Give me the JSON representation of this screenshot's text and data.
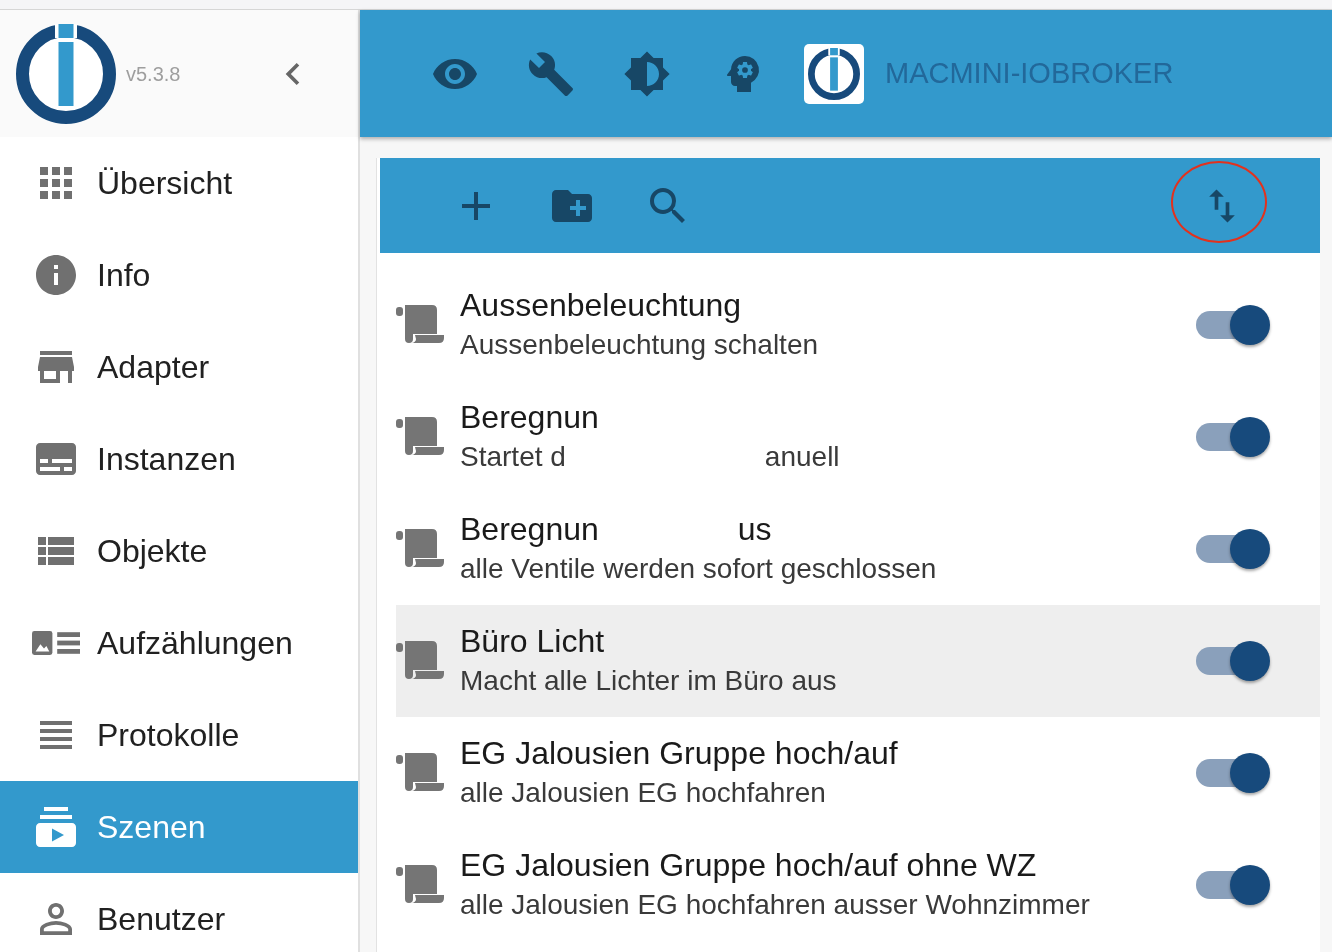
{
  "sidebar": {
    "version": "v5.3.8",
    "items": [
      {
        "label": "Übersicht",
        "selected": false
      },
      {
        "label": "Info",
        "selected": false
      },
      {
        "label": "Adapter",
        "selected": false
      },
      {
        "label": "Instanzen",
        "selected": false
      },
      {
        "label": "Objekte",
        "selected": false
      },
      {
        "label": "Aufzählungen",
        "selected": false
      },
      {
        "label": "Protokolle",
        "selected": false
      },
      {
        "label": "Szenen",
        "selected": true
      },
      {
        "label": "Benutzer",
        "selected": false
      }
    ]
  },
  "header": {
    "host": "MACMINI-IOBROKER"
  },
  "toolbar": {
    "sort_button": {
      "highlighted": true
    }
  },
  "scenes": [
    {
      "title": [
        "Aussenbeleuchtung"
      ],
      "description": [
        "Aussenbeleuchtung schalten"
      ],
      "selected": false,
      "on": true
    },
    {
      "title": [
        "Beregnun"
      ],
      "description": [
        "Startet d",
        "anuell"
      ],
      "selected": false,
      "on": true
    },
    {
      "title": [
        "Beregnun",
        "us"
      ],
      "description": [
        "alle Ventile werden sofort geschlossen"
      ],
      "selected": false,
      "on": true
    },
    {
      "title": [
        "Büro Licht"
      ],
      "description": [
        "Macht alle Lichter im Büro aus"
      ],
      "selected": true,
      "on": true
    },
    {
      "title": [
        "EG Jalousien Gruppe hoch/auf"
      ],
      "description": [
        "alle Jalousien EG hochfahren"
      ],
      "selected": false,
      "on": true
    },
    {
      "title": [
        "EG Jalousien Gruppe hoch/auf ohne WZ"
      ],
      "description": [
        "alle Jalousien EG hochfahren ausser Wohnzimmer"
      ],
      "selected": false,
      "on": true
    }
  ]
}
